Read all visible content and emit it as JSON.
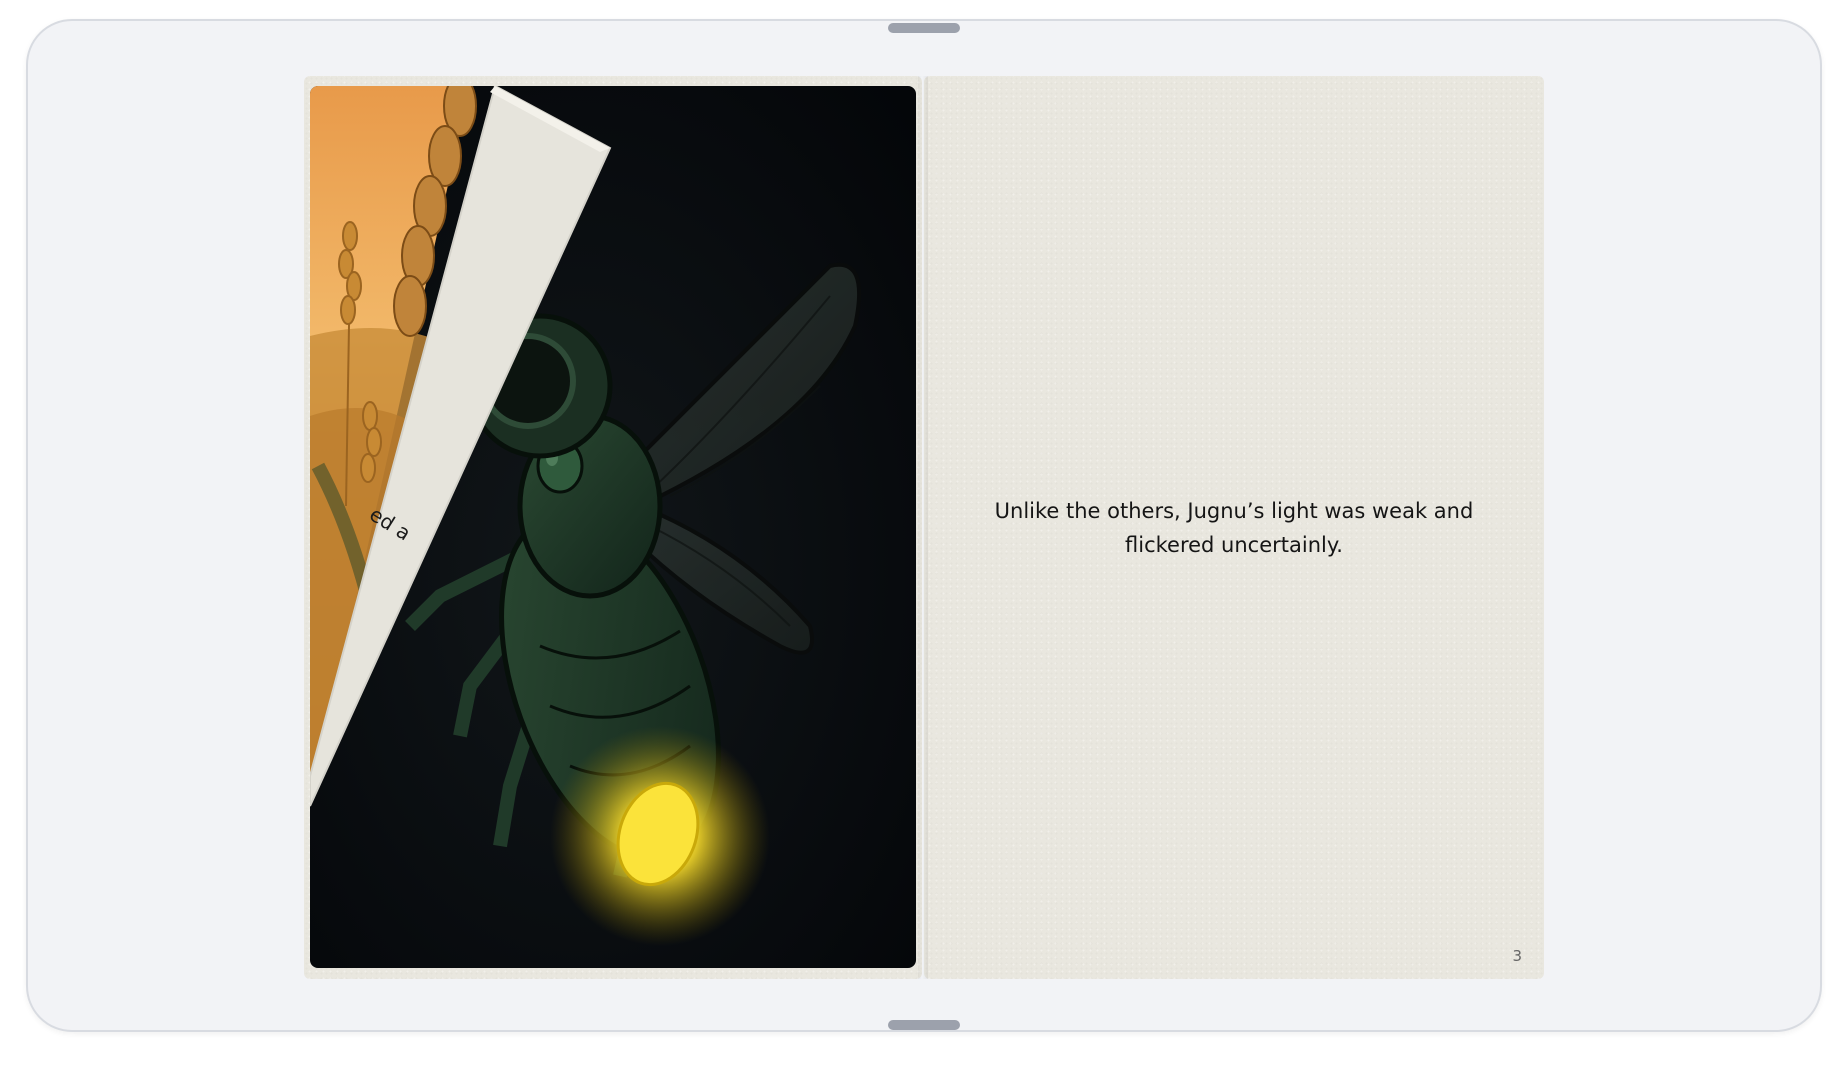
{
  "book": {
    "left_page": {
      "illustration_subject": "firefly-illustration",
      "curl_fragment": "ed a"
    },
    "right_page": {
      "text": "Unlike the others, Jugnu’s light was weak and flickered uncertainly.",
      "page_number": "3"
    }
  },
  "colors": {
    "frame_bg": "#f2f3f6",
    "paper": "#e9e7df",
    "night_bg": "#05070a",
    "sunset_top": "#e8a04f",
    "glow": "#fbe33a",
    "handle": "#9ca1ac"
  },
  "icons": {
    "top_handle": "drag-handle-icon",
    "bottom_handle": "drag-handle-icon"
  }
}
